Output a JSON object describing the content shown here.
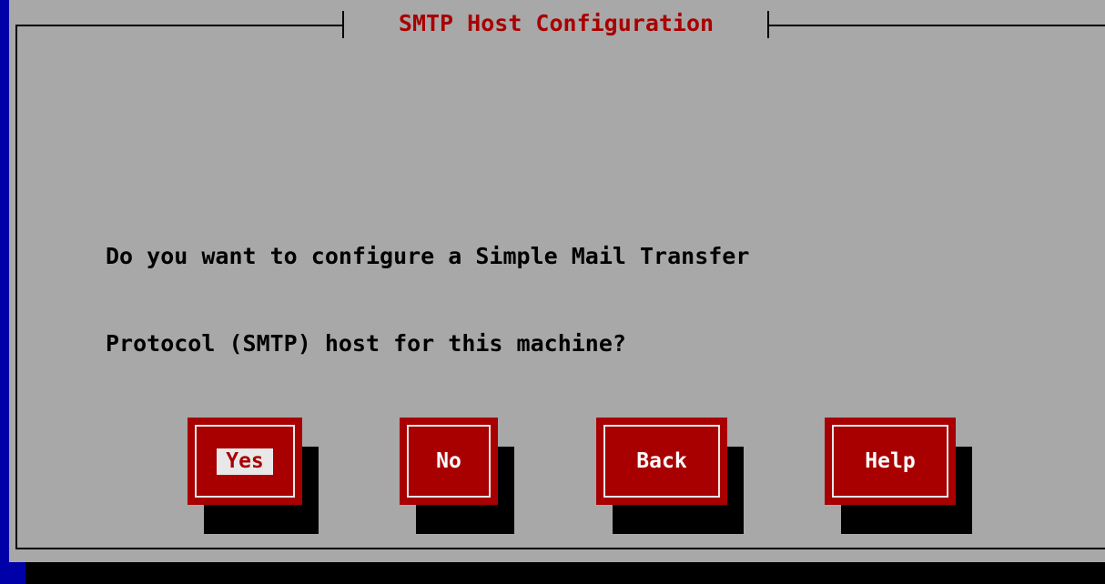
{
  "dialog": {
    "title": "SMTP Host Configuration",
    "message_line1": "Do you want to configure a Simple Mail Transfer",
    "message_line2": "Protocol (SMTP) host for this machine?"
  },
  "buttons": [
    {
      "label": "Yes",
      "focused": true
    },
    {
      "label": "No",
      "focused": false
    },
    {
      "label": "Back",
      "focused": false
    },
    {
      "label": "Help",
      "focused": false
    }
  ],
  "colors": {
    "background": "#0000a8",
    "dialog": "#a8a8a8",
    "title": "#a80000",
    "button": "#a80000",
    "button_text": "#ffffff",
    "shadow": "#000000"
  }
}
